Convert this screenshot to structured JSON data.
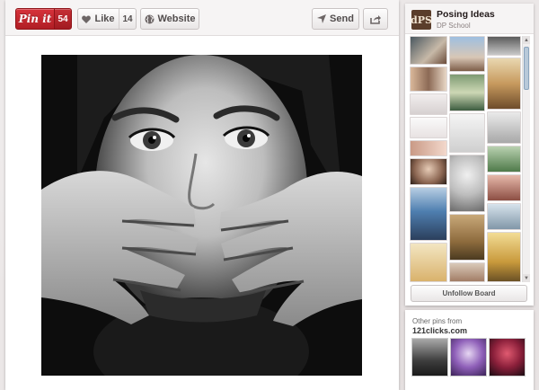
{
  "toolbar": {
    "pinit_label": "Pin it",
    "pinit_count": "54",
    "like_label": "Like",
    "like_count": "14",
    "website_label": "Website",
    "send_label": "Send"
  },
  "board": {
    "avatar_text": "dPS",
    "title": "Posing Ideas",
    "owner": "DP School",
    "unfollow_label": "Unfollow Board"
  },
  "other_pins": {
    "label": "Other pins from",
    "source": "121clicks.com"
  },
  "icons": {
    "like": "heart-icon",
    "website": "globe-icon",
    "send": "send-arrow-icon",
    "share": "share-icon"
  },
  "colors": {
    "pinit_red": "#c4262e",
    "background": "#ece9e9"
  }
}
